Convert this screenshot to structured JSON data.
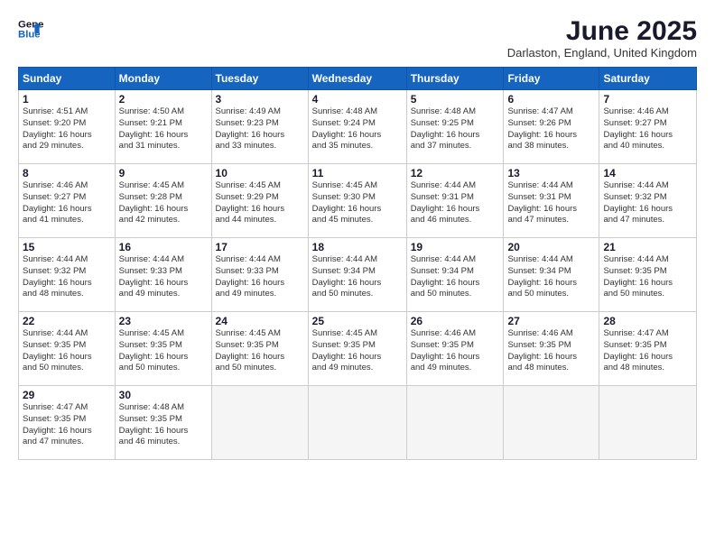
{
  "header": {
    "logo_line1": "General",
    "logo_line2": "Blue",
    "title": "June 2025",
    "location": "Darlaston, England, United Kingdom"
  },
  "columns": [
    "Sunday",
    "Monday",
    "Tuesday",
    "Wednesday",
    "Thursday",
    "Friday",
    "Saturday"
  ],
  "weeks": [
    [
      {
        "day": "1",
        "info": "Sunrise: 4:51 AM\nSunset: 9:20 PM\nDaylight: 16 hours\nand 29 minutes."
      },
      {
        "day": "2",
        "info": "Sunrise: 4:50 AM\nSunset: 9:21 PM\nDaylight: 16 hours\nand 31 minutes."
      },
      {
        "day": "3",
        "info": "Sunrise: 4:49 AM\nSunset: 9:23 PM\nDaylight: 16 hours\nand 33 minutes."
      },
      {
        "day": "4",
        "info": "Sunrise: 4:48 AM\nSunset: 9:24 PM\nDaylight: 16 hours\nand 35 minutes."
      },
      {
        "day": "5",
        "info": "Sunrise: 4:48 AM\nSunset: 9:25 PM\nDaylight: 16 hours\nand 37 minutes."
      },
      {
        "day": "6",
        "info": "Sunrise: 4:47 AM\nSunset: 9:26 PM\nDaylight: 16 hours\nand 38 minutes."
      },
      {
        "day": "7",
        "info": "Sunrise: 4:46 AM\nSunset: 9:27 PM\nDaylight: 16 hours\nand 40 minutes."
      }
    ],
    [
      {
        "day": "8",
        "info": "Sunrise: 4:46 AM\nSunset: 9:27 PM\nDaylight: 16 hours\nand 41 minutes."
      },
      {
        "day": "9",
        "info": "Sunrise: 4:45 AM\nSunset: 9:28 PM\nDaylight: 16 hours\nand 42 minutes."
      },
      {
        "day": "10",
        "info": "Sunrise: 4:45 AM\nSunset: 9:29 PM\nDaylight: 16 hours\nand 44 minutes."
      },
      {
        "day": "11",
        "info": "Sunrise: 4:45 AM\nSunset: 9:30 PM\nDaylight: 16 hours\nand 45 minutes."
      },
      {
        "day": "12",
        "info": "Sunrise: 4:44 AM\nSunset: 9:31 PM\nDaylight: 16 hours\nand 46 minutes."
      },
      {
        "day": "13",
        "info": "Sunrise: 4:44 AM\nSunset: 9:31 PM\nDaylight: 16 hours\nand 47 minutes."
      },
      {
        "day": "14",
        "info": "Sunrise: 4:44 AM\nSunset: 9:32 PM\nDaylight: 16 hours\nand 47 minutes."
      }
    ],
    [
      {
        "day": "15",
        "info": "Sunrise: 4:44 AM\nSunset: 9:32 PM\nDaylight: 16 hours\nand 48 minutes."
      },
      {
        "day": "16",
        "info": "Sunrise: 4:44 AM\nSunset: 9:33 PM\nDaylight: 16 hours\nand 49 minutes."
      },
      {
        "day": "17",
        "info": "Sunrise: 4:44 AM\nSunset: 9:33 PM\nDaylight: 16 hours\nand 49 minutes."
      },
      {
        "day": "18",
        "info": "Sunrise: 4:44 AM\nSunset: 9:34 PM\nDaylight: 16 hours\nand 50 minutes."
      },
      {
        "day": "19",
        "info": "Sunrise: 4:44 AM\nSunset: 9:34 PM\nDaylight: 16 hours\nand 50 minutes."
      },
      {
        "day": "20",
        "info": "Sunrise: 4:44 AM\nSunset: 9:34 PM\nDaylight: 16 hours\nand 50 minutes."
      },
      {
        "day": "21",
        "info": "Sunrise: 4:44 AM\nSunset: 9:35 PM\nDaylight: 16 hours\nand 50 minutes."
      }
    ],
    [
      {
        "day": "22",
        "info": "Sunrise: 4:44 AM\nSunset: 9:35 PM\nDaylight: 16 hours\nand 50 minutes."
      },
      {
        "day": "23",
        "info": "Sunrise: 4:45 AM\nSunset: 9:35 PM\nDaylight: 16 hours\nand 50 minutes."
      },
      {
        "day": "24",
        "info": "Sunrise: 4:45 AM\nSunset: 9:35 PM\nDaylight: 16 hours\nand 50 minutes."
      },
      {
        "day": "25",
        "info": "Sunrise: 4:45 AM\nSunset: 9:35 PM\nDaylight: 16 hours\nand 49 minutes."
      },
      {
        "day": "26",
        "info": "Sunrise: 4:46 AM\nSunset: 9:35 PM\nDaylight: 16 hours\nand 49 minutes."
      },
      {
        "day": "27",
        "info": "Sunrise: 4:46 AM\nSunset: 9:35 PM\nDaylight: 16 hours\nand 48 minutes."
      },
      {
        "day": "28",
        "info": "Sunrise: 4:47 AM\nSunset: 9:35 PM\nDaylight: 16 hours\nand 48 minutes."
      }
    ],
    [
      {
        "day": "29",
        "info": "Sunrise: 4:47 AM\nSunset: 9:35 PM\nDaylight: 16 hours\nand 47 minutes."
      },
      {
        "day": "30",
        "info": "Sunrise: 4:48 AM\nSunset: 9:35 PM\nDaylight: 16 hours\nand 46 minutes."
      },
      {
        "day": "",
        "info": ""
      },
      {
        "day": "",
        "info": ""
      },
      {
        "day": "",
        "info": ""
      },
      {
        "day": "",
        "info": ""
      },
      {
        "day": "",
        "info": ""
      }
    ]
  ]
}
